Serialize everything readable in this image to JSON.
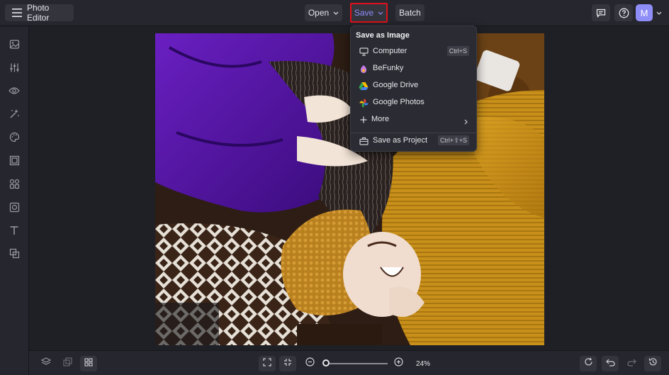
{
  "app": {
    "title": "Photo Editor"
  },
  "topbar": {
    "open_label": "Open",
    "save_label": "Save",
    "batch_label": "Batch",
    "avatar_initial": "M"
  },
  "save_menu": {
    "heading": "Save as Image",
    "items": [
      {
        "label": "Computer",
        "shortcut": "Ctrl+S",
        "icon": "monitor-icon"
      },
      {
        "label": "BeFunky",
        "icon": "befunky-logo-icon"
      },
      {
        "label": "Google Drive",
        "icon": "google-drive-icon"
      },
      {
        "label": "Google Photos",
        "icon": "google-photos-icon"
      },
      {
        "label": "More",
        "icon": "plus-icon",
        "submenu": true
      },
      {
        "label": "Save as Project",
        "shortcut": "Ctrl+⇧+S",
        "icon": "briefcase-icon"
      }
    ]
  },
  "sidebar": {
    "icons": [
      "image-icon",
      "sliders-icon",
      "eye-icon",
      "magic-wand-icon",
      "palette-icon",
      "frame-icon",
      "graphics-icon",
      "texture-icon",
      "text-icon",
      "overlay-icon"
    ]
  },
  "bottombar": {
    "zoom_percent": "24%",
    "zoom_level": 0.24
  },
  "colors": {
    "accent": "#8f8df7",
    "highlight_border": "#e0111c",
    "background": "#1f2026",
    "panel": "#26272e"
  }
}
